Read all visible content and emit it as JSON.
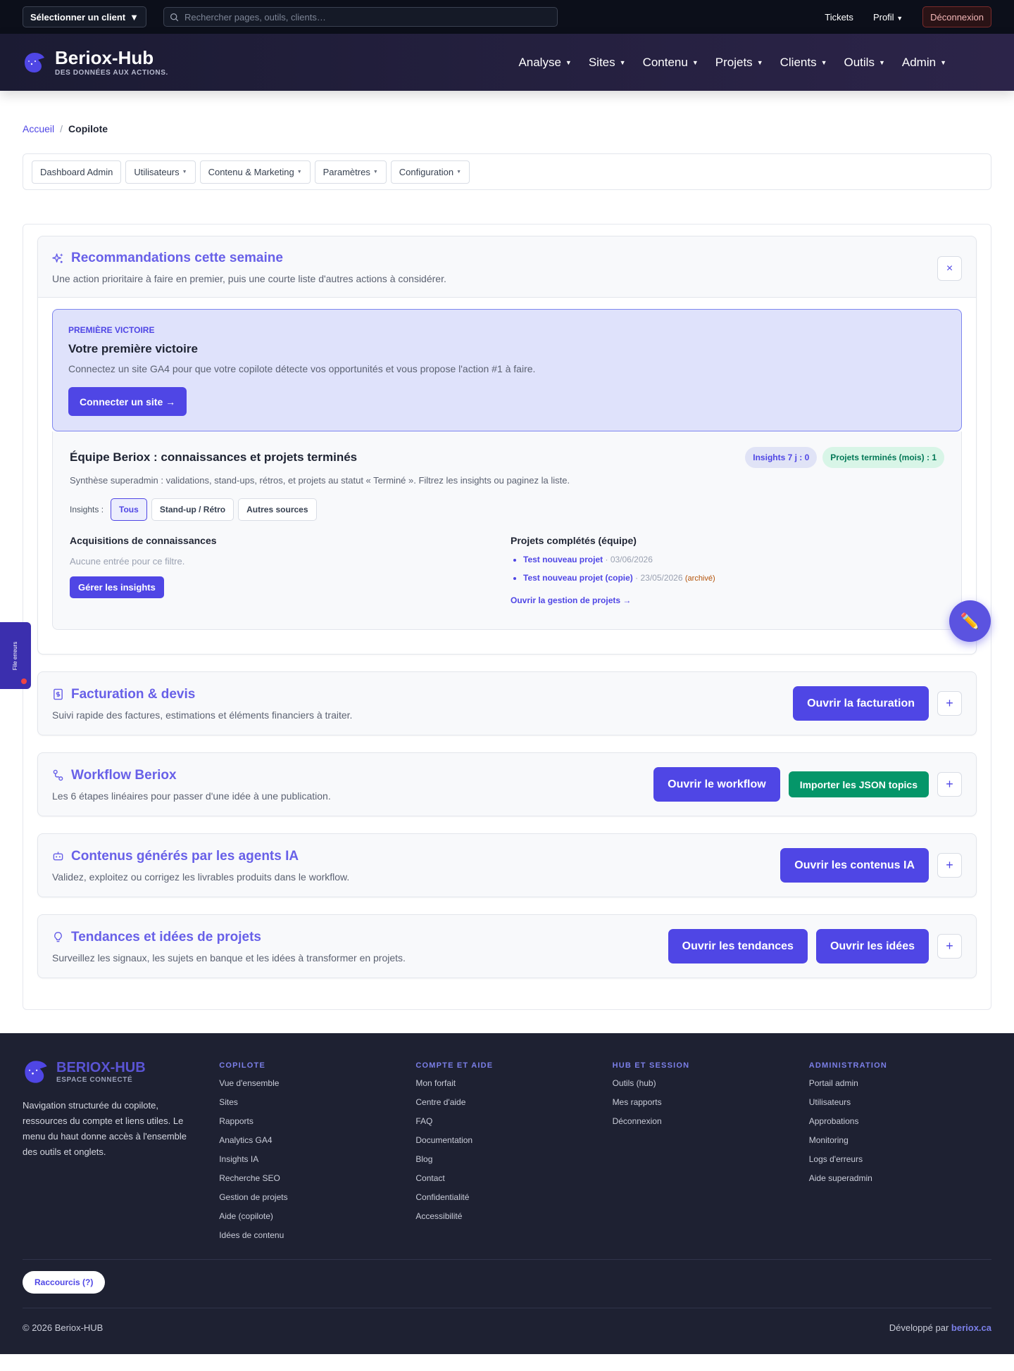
{
  "topbar": {
    "client_select": "Sélectionner un client",
    "search_placeholder": "Rechercher pages, outils, clients…",
    "tickets": "Tickets",
    "profile": "Profil",
    "logout": "Déconnexion"
  },
  "header": {
    "brand": "Beriox-Hub",
    "tagline": "DES DONNÉES AUX ACTIONS.",
    "nav": [
      "Analyse",
      "Sites",
      "Contenu",
      "Projets",
      "Clients",
      "Outils",
      "Admin"
    ]
  },
  "breadcrumb": {
    "home": "Accueil",
    "sep": "/",
    "current": "Copilote"
  },
  "admin_bar": [
    "Dashboard Admin",
    "Utilisateurs",
    "Contenu & Marketing",
    "Paramètres",
    "Configuration"
  ],
  "recommendations": {
    "title": "Recommandations cette semaine",
    "subtitle": "Une action prioritaire à faire en premier, puis une courte liste d'autres actions à considérer.",
    "close": "×",
    "victory": {
      "kicker": "PREMIÈRE VICTOIRE",
      "title": "Votre première victoire",
      "text": "Connectez un site GA4 pour que votre copilote détecte vos opportunités et vous propose l'action #1 à faire.",
      "button": "Connecter un site →"
    },
    "team": {
      "title": "Équipe Beriox : connaissances et projets terminés",
      "badge_insights": "Insights 7 j : 0",
      "badge_projects": "Projets terminés (mois) : 1",
      "subtitle": "Synthèse superadmin : validations, stand-ups, rétros, et projets au statut « Terminé ». Filtrez les insights ou paginez la liste.",
      "filter_label": "Insights :",
      "filters": [
        "Tous",
        "Stand-up / Rétro",
        "Autres sources"
      ],
      "acq_title": "Acquisitions de connaissances",
      "acq_empty": "Aucune entrée pour ce filtre.",
      "acq_button": "Gérer les insights",
      "proj_title": "Projets complétés (équipe)",
      "projects": [
        {
          "name": "Test nouveau projet",
          "date": "· 03/06/2026",
          "note": ""
        },
        {
          "name": "Test nouveau projet (copie)",
          "date": "· 23/05/2026",
          "note": "(archivé)"
        }
      ],
      "proj_link": "Ouvrir la gestion de projets →"
    }
  },
  "sections": {
    "billing": {
      "title": "Facturation & devis",
      "subtitle": "Suivi rapide des factures, estimations et éléments financiers à traiter.",
      "button": "Ouvrir la facturation",
      "toggle": "+"
    },
    "workflow": {
      "title": "Workflow Beriox",
      "subtitle": "Les 6 étapes linéaires pour passer d'une idée à une publication.",
      "button": "Ouvrir le workflow",
      "button2": "Importer les JSON topics",
      "toggle": "+"
    },
    "ai": {
      "title": "Contenus générés par les agents IA",
      "subtitle": "Validez, exploitez ou corrigez les livrables produits dans le workflow.",
      "button": "Ouvrir les contenus IA",
      "toggle": "+"
    },
    "trends": {
      "title": "Tendances et idées de projets",
      "subtitle": "Surveillez les signaux, les sujets en banque et les idées à transformer en projets.",
      "button": "Ouvrir les tendances",
      "button2": "Ouvrir les idées",
      "toggle": "+"
    }
  },
  "floating": {
    "side_tab": "File erreurs",
    "fab_icon": "pencil-icon"
  },
  "footer": {
    "brand": "BERIOX-HUB",
    "brand_tag": "ESPACE CONNECTÉ",
    "desc": "Navigation structurée du copilote, ressources du compte et liens utiles. Le menu du haut donne accès à l'ensemble des outils et onglets.",
    "cols": [
      {
        "title": "COPILOTE",
        "links": [
          "Vue d'ensemble",
          "Sites",
          "Rapports",
          "Analytics GA4",
          "Insights IA",
          "Recherche SEO",
          "Gestion de projets",
          "Aide (copilote)",
          "Idées de contenu"
        ]
      },
      {
        "title": "COMPTE ET AIDE",
        "links": [
          "Mon forfait",
          "Centre d'aide",
          "FAQ",
          "Documentation",
          "Blog",
          "Contact",
          "Confidentialité",
          "Accessibilité"
        ]
      },
      {
        "title": "HUB ET SESSION",
        "links": [
          "Outils (hub)",
          "Mes rapports",
          "Déconnexion"
        ]
      },
      {
        "title": "ADMINISTRATION",
        "links": [
          "Portail admin",
          "Utilisateurs",
          "Approbations",
          "Monitoring",
          "Logs d'erreurs",
          "Aide superadmin"
        ]
      }
    ],
    "shortcuts": "Raccourcis (?)",
    "copyright": "© 2026 Beriox-HUB",
    "dev_prefix": "Développé par",
    "dev_link": "beriox.ca"
  },
  "colors": {
    "accent": "#4f46e5",
    "green": "#059669",
    "dark": "#0c0f1a",
    "footer": "#1e2132"
  }
}
